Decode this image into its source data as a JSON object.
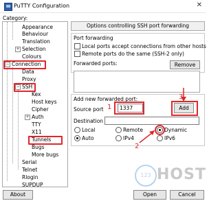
{
  "window": {
    "title": "PuTTY Configuration",
    "close_glyph": "✕"
  },
  "category_label": "Category:",
  "tree": {
    "appearance": "Appearance",
    "behaviour": "Behaviour",
    "translation": "Translation",
    "selection": "Selection",
    "colours": "Colours",
    "connection": "Connection",
    "data": "Data",
    "proxy": "Proxy",
    "ssh": "SSH",
    "kex": "Kex",
    "host_keys": "Host keys",
    "cipher": "Cipher",
    "auth": "Auth",
    "tty": "TTY",
    "x11": "X11",
    "tunnels": "Tunnels",
    "bugs": "Bugs",
    "more_bugs": "More bugs",
    "serial": "Serial",
    "telnet": "Telnet",
    "rlogin": "Rlogin",
    "supdup": "SUPDUP",
    "expand_plus": "+",
    "expand_minus": "−"
  },
  "panel": {
    "title": "Options controlling SSH port forwarding",
    "port_forwarding_label": "Port forwarding",
    "local_ports_label": "Local ports accept connections from other hosts",
    "remote_ports_label": "Remote ports do the same (SSH-2 only)",
    "forwarded_ports_label": "Forwarded ports:",
    "remove_button": "Remove",
    "add_new_label": "Add new forwarded port:",
    "source_port_label": "Source port",
    "source_port_value": "1337",
    "add_button": "Add",
    "destination_label": "Destination",
    "destination_value": "",
    "radio_local": "Local",
    "radio_remote": "Remote",
    "radio_dynamic": "Dynamic",
    "radio_auto": "Auto",
    "radio_ipv4": "IPv4",
    "radio_ipv6": "IPv6",
    "forward_type_selected": "Dynamic",
    "ip_version_selected": "Auto"
  },
  "annotations": {
    "step1": "1",
    "step2": "2",
    "step3": "3",
    "color": "#e0252b"
  },
  "watermark": {
    "badge": "123",
    "text": "HOST"
  },
  "footer": {
    "about": "About",
    "open": "Open",
    "cancel": "Cancel"
  }
}
